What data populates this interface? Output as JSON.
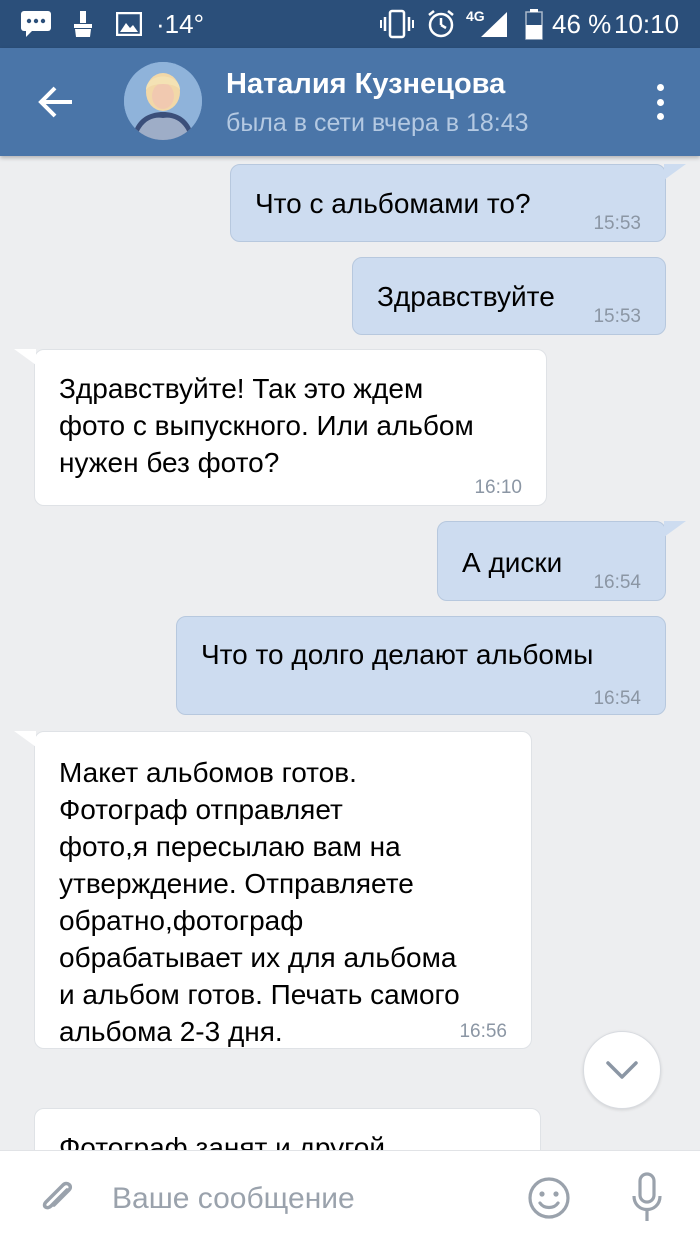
{
  "status_bar": {
    "temperature": "·14°",
    "network": "4G",
    "battery": "46 %",
    "time": "10:10"
  },
  "header": {
    "contact_name": "Наталия Кузнецова",
    "contact_status": "была в сети вчера в 18:43"
  },
  "messages": [
    {
      "direction": "out",
      "text": "Что с альбомами то?",
      "time": "15:53"
    },
    {
      "direction": "out",
      "text": "Здравствуйте",
      "time": "15:53"
    },
    {
      "direction": "in",
      "text": "Здравствуйте! Так это ждем\nфото с выпускного. Или альбом\nнужен без фото?",
      "time": "16:10"
    },
    {
      "direction": "out",
      "text": "А диски",
      "time": "16:54"
    },
    {
      "direction": "out",
      "text": "Что то долго делают альбомы",
      "time": "16:54"
    },
    {
      "direction": "in",
      "text": "Макет альбомов готов.\nФотограф отправляет\nфото,я пересылаю вам на\nутверждение. Отправляете\nобратно,фотограф\nобрабатывает их для альбома\nи альбом готов. Печать самого\nальбома 2-3 дня.",
      "time": "16:56"
    },
    {
      "direction": "in",
      "text": "Фотограф занят и другой",
      "time": ""
    }
  ],
  "composer": {
    "placeholder": "Ваше сообщение"
  }
}
